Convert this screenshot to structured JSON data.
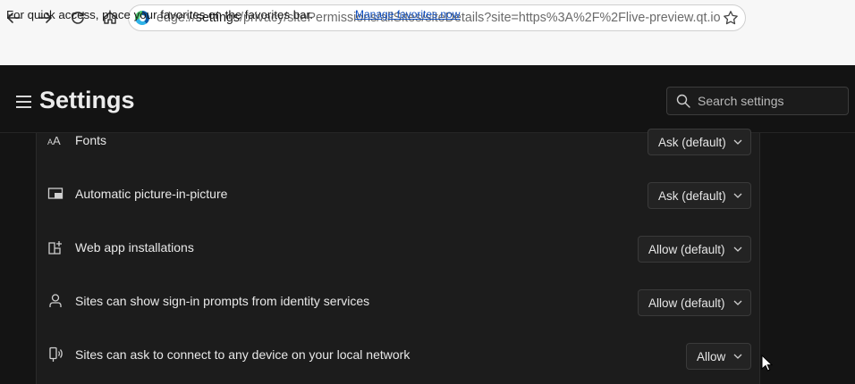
{
  "browser": {
    "address_url_prefix": "edge://",
    "address_url_host": "settings",
    "address_url_path": "/privacy/sitePermissions/allSites/siteDetails?site=https%3A%2F%2Flive-preview.qt.io",
    "icons": [
      "back-icon",
      "forward-icon",
      "refresh-icon",
      "home-icon",
      "edge-logo-icon",
      "favorite-star-icon"
    ]
  },
  "favorites_bar": {
    "message": "For quick access, place your favorites on the favorites bar.",
    "link": "Manage favorites now"
  },
  "settings": {
    "title": "Settings",
    "search_placeholder": "Search settings"
  },
  "permissions": [
    {
      "icon": "fonts-icon",
      "label": "Fonts",
      "value": "Ask (default)"
    },
    {
      "icon": "picture-in-picture-icon",
      "label": "Automatic picture-in-picture",
      "value": "Ask (default)"
    },
    {
      "icon": "app-install-icon",
      "label": "Web app installations",
      "value": "Allow (default)"
    },
    {
      "icon": "identity-person-icon",
      "label": "Sites can show sign-in prompts from identity services",
      "value": "Allow (default)"
    },
    {
      "icon": "local-network-device-icon",
      "label": "Sites can ask to connect to any device on your local network",
      "value": "Allow"
    }
  ],
  "colors": {
    "page_bg": "#141414",
    "card_bg": "#1c1c1c",
    "link": "#0f4ec0"
  }
}
